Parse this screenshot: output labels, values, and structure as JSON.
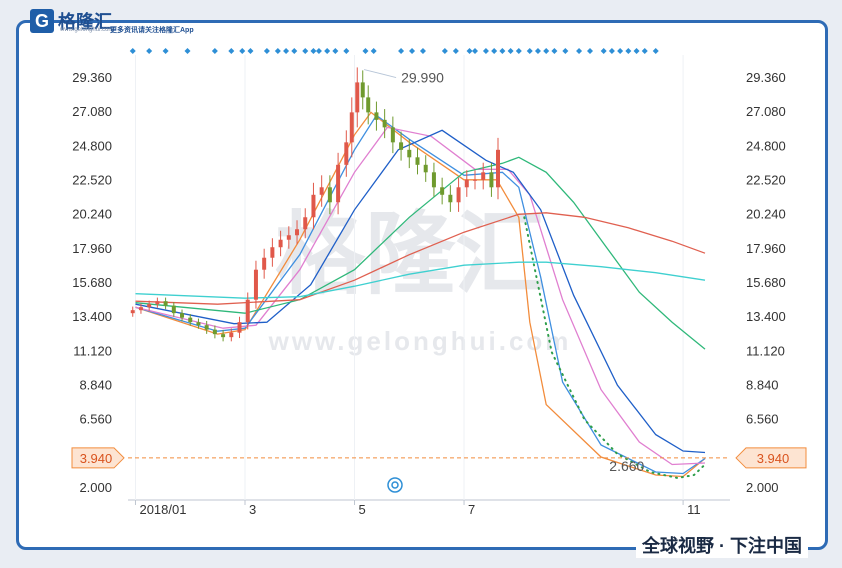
{
  "brand": {
    "logo_letter": "G",
    "logo_text": "格隆汇",
    "logo_domain": "www.gelonghui.com",
    "logo_tagline": "更多资讯请关注格隆汇App",
    "watermark_text": "格隆汇",
    "watermark_url": "www.gelonghui.com",
    "slogan": "全球视野 · 下注中国"
  },
  "colors": {
    "frame": "#2e6bb5",
    "up_candle": "#e0584a",
    "down_candle": "#6f9a2e",
    "event_dot": "#2e8fd6",
    "price_marker": "#f28c3c"
  },
  "chart_data": {
    "type": "line",
    "subtype": "candlestick-with-moving-averages",
    "y_ticks": [
      "29.360",
      "27.080",
      "24.800",
      "22.520",
      "20.240",
      "17.960",
      "15.680",
      "13.400",
      "11.120",
      "8.840",
      "6.560",
      "2.000"
    ],
    "ylim": [
      2.0,
      29.99
    ],
    "x_tick_labels": [
      "2018/01",
      "3",
      "5",
      "7",
      "11"
    ],
    "x_tick_months": [
      0,
      2,
      4,
      6,
      10
    ],
    "x_range_months": [
      -0.1,
      10.4
    ],
    "annotations": {
      "high_label": "29.990",
      "high_value": 29.99,
      "high_month": 4.12,
      "low_label": "2.660",
      "low_value": 2.66,
      "low_month": 10.15,
      "last_price_label": "3.940",
      "last_price_value": 3.94
    },
    "candles": {
      "months": [
        -0.05,
        0.1,
        0.25,
        0.4,
        0.55,
        0.7,
        0.85,
        1.0,
        1.15,
        1.3,
        1.45,
        1.6,
        1.75,
        1.9,
        2.05,
        2.2,
        2.35,
        2.5,
        2.65,
        2.8,
        2.95,
        3.1,
        3.25,
        3.4,
        3.55,
        3.7,
        3.85,
        3.95,
        4.05,
        4.15,
        4.25,
        4.4,
        4.55,
        4.7,
        4.85,
        5.0,
        5.15,
        5.3,
        5.45,
        5.6,
        5.75,
        5.9,
        6.05,
        6.2,
        6.35,
        6.5,
        6.62
      ],
      "closes": [
        13.8,
        14.0,
        14.2,
        14.4,
        14.1,
        13.6,
        13.3,
        13.0,
        12.8,
        12.5,
        12.2,
        12.0,
        12.3,
        13.0,
        14.5,
        16.5,
        17.3,
        18.0,
        18.5,
        18.8,
        19.2,
        20.0,
        21.5,
        22.0,
        21.0,
        23.5,
        25.0,
        27.0,
        29.0,
        28.0,
        27.0,
        26.5,
        26.0,
        25.0,
        24.5,
        24.0,
        23.5,
        23.0,
        22.0,
        21.5,
        21.0,
        22.0,
        22.5,
        22.5,
        23.0,
        22.0,
        24.5
      ],
      "ranges": [
        0.6,
        0.6,
        0.6,
        0.6,
        0.6,
        0.6,
        0.6,
        0.6,
        0.6,
        0.7,
        0.7,
        0.7,
        0.7,
        0.9,
        1.2,
        1.5,
        1.5,
        1.5,
        1.5,
        1.5,
        1.5,
        1.5,
        2.0,
        2.0,
        2.0,
        2.0,
        2.0,
        2.5,
        2.5,
        2.0,
        2.0,
        1.8,
        1.8,
        1.8,
        1.8,
        1.8,
        1.6,
        1.6,
        1.6,
        1.6,
        1.6,
        1.6,
        1.6,
        1.6,
        1.6,
        1.6,
        2.0
      ]
    },
    "series": [
      {
        "color": "#f28c3c",
        "x": [
          0,
          1.5,
          2.0,
          3.0,
          4.0,
          4.3,
          5.0,
          6.0,
          6.6,
          7.0,
          7.2,
          7.5,
          8.5,
          9.5,
          10.0,
          10.4
        ],
        "y": [
          14.0,
          12.2,
          12.5,
          18.5,
          25.5,
          27.0,
          25.0,
          22.5,
          22.5,
          20.0,
          13.0,
          7.5,
          4.0,
          2.8,
          2.7,
          3.9
        ]
      },
      {
        "color": "#3f8fe0",
        "x": [
          0,
          1.5,
          2.0,
          3.0,
          4.0,
          4.4,
          5.0,
          6.0,
          6.7,
          7.0,
          7.4,
          7.8,
          8.5,
          9.5,
          10.0,
          10.4
        ],
        "y": [
          14.0,
          12.4,
          12.6,
          17.5,
          24.5,
          26.8,
          25.2,
          22.8,
          23.0,
          22.0,
          16.0,
          9.0,
          4.8,
          3.0,
          2.9,
          3.9
        ]
      },
      {
        "color": "#e07fd0",
        "x": [
          0,
          1.6,
          2.2,
          3.0,
          4.0,
          4.6,
          5.4,
          6.2,
          6.8,
          7.2,
          7.8,
          8.5,
          9.2,
          9.8,
          10.4
        ],
        "y": [
          14.0,
          12.6,
          12.8,
          16.5,
          23.0,
          26.0,
          25.4,
          23.2,
          23.2,
          21.5,
          14.5,
          8.5,
          5.0,
          3.5,
          3.6
        ]
      },
      {
        "color": "#1f5fc8",
        "x": [
          0,
          1.8,
          2.4,
          3.2,
          4.0,
          4.8,
          5.6,
          6.4,
          6.9,
          7.4,
          8.0,
          8.8,
          9.5,
          10.0,
          10.4
        ],
        "y": [
          14.2,
          12.9,
          13.0,
          15.5,
          20.5,
          24.5,
          25.8,
          23.8,
          23.0,
          20.5,
          14.8,
          8.8,
          5.5,
          4.4,
          4.3
        ]
      },
      {
        "color": "#2fb87a",
        "x": [
          0,
          2.0,
          3.0,
          4.0,
          5.0,
          6.0,
          6.7,
          7.0,
          7.5,
          8.0,
          8.6,
          9.2,
          9.8,
          10.4
        ],
        "y": [
          14.3,
          13.6,
          14.5,
          16.5,
          20.0,
          23.0,
          23.6,
          24.0,
          23.0,
          21.0,
          18.0,
          15.0,
          13.0,
          11.2
        ]
      },
      {
        "color": "#e06050",
        "x": [
          0,
          1.5,
          3.0,
          4.0,
          5.0,
          6.0,
          7.0,
          7.5,
          8.2,
          9.0,
          9.8,
          10.4
        ],
        "y": [
          14.4,
          14.2,
          14.5,
          15.8,
          17.5,
          19.0,
          20.2,
          20.3,
          20.0,
          19.3,
          18.4,
          17.6
        ]
      },
      {
        "color": "#3fd0d0",
        "x": [
          0,
          2.0,
          3.0,
          4.0,
          5.0,
          6.0,
          7.0,
          7.5,
          8.5,
          9.5,
          10.4
        ],
        "y": [
          14.9,
          14.6,
          14.7,
          15.4,
          16.2,
          16.8,
          17.0,
          17.0,
          16.7,
          16.3,
          15.8
        ]
      }
    ],
    "dotted_series": {
      "color": "#2e9e4a",
      "x": [
        7.1,
        7.6,
        8.2,
        8.8,
        9.4,
        9.9,
        10.2,
        10.4
      ],
      "y": [
        20.0,
        11.0,
        6.5,
        4.2,
        3.0,
        2.6,
        2.8,
        3.5
      ]
    },
    "event_markers": {
      "months": [
        -0.05,
        0.25,
        0.55,
        0.95,
        1.45,
        1.75,
        1.95,
        2.1,
        2.4,
        2.6,
        2.75,
        2.9,
        3.1,
        3.25,
        3.35,
        3.5,
        3.65,
        3.85,
        4.2,
        4.35,
        4.85,
        5.05,
        5.25,
        5.65,
        5.85,
        6.1,
        6.2,
        6.4,
        6.55,
        6.7,
        6.85,
        7.0,
        7.2,
        7.35,
        7.5,
        7.65,
        7.85,
        8.1,
        8.3,
        8.55,
        8.7,
        8.85,
        9.0,
        9.15,
        9.3,
        9.5
      ]
    }
  }
}
